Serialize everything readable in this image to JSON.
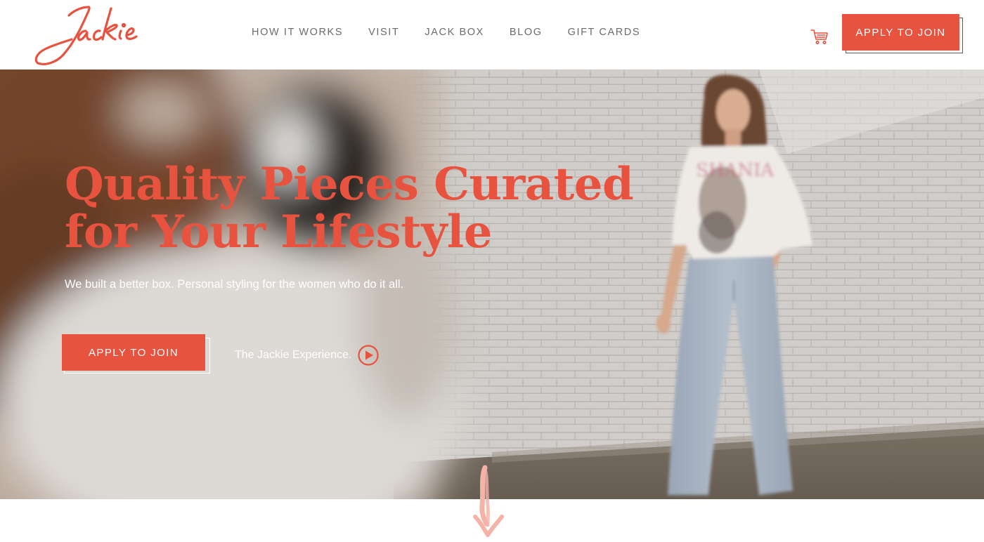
{
  "brand": {
    "logo_text": "Jackie",
    "accent_color": "#e8533f"
  },
  "header": {
    "nav": [
      {
        "label": "HOW IT WORKS"
      },
      {
        "label": "VISIT"
      },
      {
        "label": "JACK BOX"
      },
      {
        "label": "BLOG"
      },
      {
        "label": "GIFT CARDS"
      }
    ],
    "cart_icon": "cart-icon",
    "cta_label": "APPLY TO JOIN"
  },
  "hero": {
    "title_line1": "Quality Pieces Curated",
    "title_line2": "for Your Lifestyle",
    "subtitle": "We built a better box. Personal styling for the women who do it all.",
    "cta_label": "APPLY TO JOIN",
    "video_link_label": "The Jackie Experience.",
    "video_icon": "play-circle-icon",
    "scroll_icon": "scroll-down-arrow-icon"
  }
}
